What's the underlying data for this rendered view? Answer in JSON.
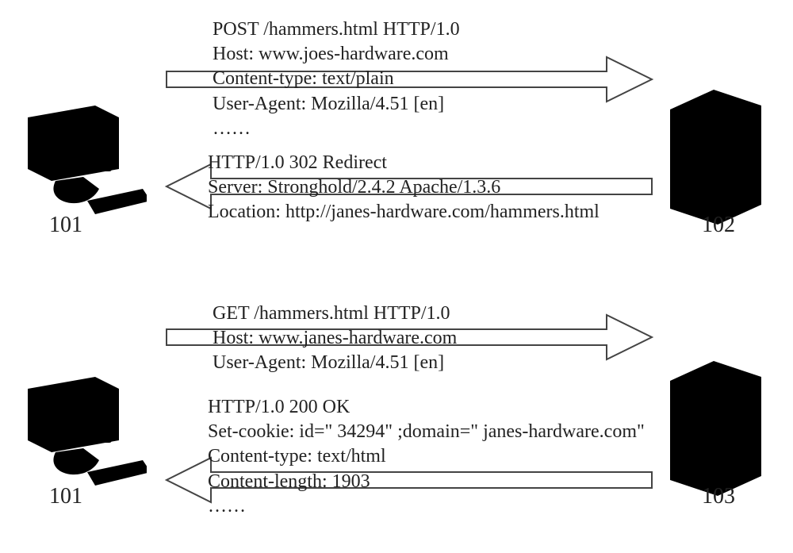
{
  "scene1": {
    "client_label": "101",
    "server_label": "102",
    "request": {
      "line1": "POST /hammers.html HTTP/1.0",
      "line2": "Host: www.joes-hardware.com",
      "line3": "Content-type: text/plain",
      "line4": "User-Agent: Mozilla/4.51 [en]",
      "line5": "……"
    },
    "response": {
      "line1": "HTTP/1.0 302 Redirect",
      "line2": "Server: Stronghold/2.4.2 Apache/1.3.6",
      "line3": "Location: http://janes-hardware.com/hammers.html"
    }
  },
  "scene2": {
    "client_label": "101",
    "server_label": "103",
    "request": {
      "line1": "GET /hammers.html HTTP/1.0",
      "line2": "Host: www.janes-hardware.com",
      "line3": "User-Agent: Mozilla/4.51 [en]"
    },
    "response": {
      "line1": "HTTP/1.0 200 OK",
      "line2": "Set-cookie: id=\" 34294\" ;domain=\" janes-hardware.com\"",
      "line3": "Content-type: text/html",
      "line4": "Content-length: 1903",
      "line5": "……"
    }
  }
}
